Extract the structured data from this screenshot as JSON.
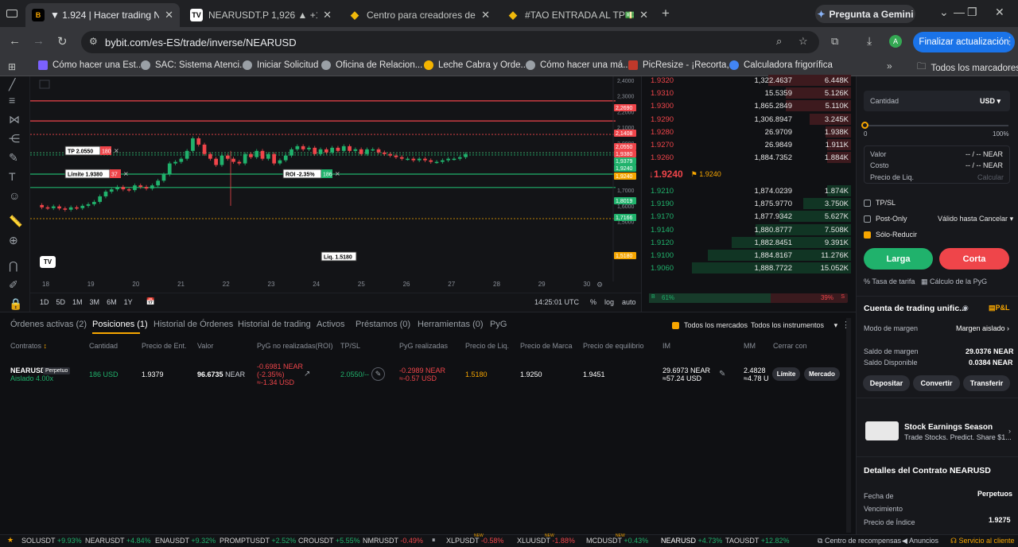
{
  "browser": {
    "tabs": [
      {
        "title": "▼ 1.924 | Hacer trading NEARUSD"
      },
      {
        "title": "NEARUSDT.P 1,926 ▲ +1.42% en"
      },
      {
        "title": "Centro para creadores de Binance"
      },
      {
        "title": "#TAO ENTRADA AL TP💵💵 LO"
      }
    ],
    "gemini": "Pregunta a Gemini",
    "url": "bybit.com/es-ES/trade/inverse/NEARUSD",
    "profile": "A",
    "update": "Finalizar actualización",
    "bookmarks": [
      "Cómo hacer una Est...",
      "SAC: Sistema Atenci...",
      "Iniciar Solicitud",
      "Oficina de Relacion...",
      "Leche Cabra y Orde...",
      "Cómo hacer una má...",
      "PicResize - ¡Recorta,...",
      "Calculadora frigorífica"
    ],
    "all_bookmarks": "Todos los marcadores"
  },
  "chart": {
    "price_axis": [
      "2,4000",
      "2,3000",
      "2,2000",
      "2,1000",
      "2,0000",
      "1,9000",
      "1,8000",
      "1,7000",
      "1,6000",
      "1,5000"
    ],
    "price_tags": [
      {
        "label": "2,2690",
        "color": "#ef454a"
      },
      {
        "label": "2,1408",
        "color": "#ef454a"
      },
      {
        "label": "2,0550",
        "color": "#ef454a"
      },
      {
        "label": "1,9380",
        "color": "#ef454a"
      },
      {
        "label": "1,9379",
        "color": "#20b26c"
      },
      {
        "label": "1,9240",
        "color": "#20b26c"
      },
      {
        "label": "1,9240",
        "color": "#f7a600"
      },
      {
        "label": "1,8019",
        "color": "#20b26c"
      },
      {
        "label": "1,7166",
        "color": "#20b26c"
      },
      {
        "label": "1,5180",
        "color": "#f7a600"
      }
    ],
    "date_axis": [
      "18",
      "19",
      "20",
      "21",
      "22",
      "23",
      "24",
      "25",
      "26",
      "27",
      "28",
      "29",
      "30"
    ],
    "tp_label": "TP 2.0550",
    "tp_qty": "180",
    "limit_label": "Límite 1.9380",
    "limit_qty": "37",
    "roi_label": "ROI -2.35%",
    "roi_qty": "186",
    "liq_label": "Liq. 1.5180",
    "timeframes": [
      "1D",
      "5D",
      "1M",
      "3M",
      "6M",
      "1Y"
    ],
    "clock": "14:25:01 UTC",
    "scale_opts": [
      "%",
      "log",
      "auto"
    ],
    "logo": "TV"
  },
  "orderbook": {
    "asks": [
      {
        "p": "1.9320",
        "q": "1,322.4637",
        "t": "6.448K",
        "w": 0.52
      },
      {
        "p": "1.9310",
        "q": "15.5359",
        "t": "5.126K",
        "w": 0.41
      },
      {
        "p": "1.9300",
        "q": "1,865.2849",
        "t": "5.110K",
        "w": 0.41
      },
      {
        "p": "1.9290",
        "q": "1,306.8947",
        "t": "3.245K",
        "w": 0.26
      },
      {
        "p": "1.9280",
        "q": "26.9709",
        "t": "1.938K",
        "w": 0.16
      },
      {
        "p": "1.9270",
        "q": "26.9849",
        "t": "1.911K",
        "w": 0.15
      },
      {
        "p": "1.9260",
        "q": "1,884.7352",
        "t": "1.884K",
        "w": 0.15
      }
    ],
    "last": "↓1.9240",
    "mark": "1.9240",
    "bids": [
      {
        "p": "1.9210",
        "q": "1,874.0239",
        "t": "1.874K",
        "w": 0.15
      },
      {
        "p": "1.9190",
        "q": "1,875.9770",
        "t": "3.750K",
        "w": 0.3
      },
      {
        "p": "1.9170",
        "q": "1,877.9342",
        "t": "5.627K",
        "w": 0.45
      },
      {
        "p": "1.9140",
        "q": "1,880.8777",
        "t": "7.508K",
        "w": 0.6
      },
      {
        "p": "1.9120",
        "q": "1,882.8451",
        "t": "9.391K",
        "w": 0.75
      },
      {
        "p": "1.9100",
        "q": "1,884.8167",
        "t": "11.276K",
        "w": 0.9
      },
      {
        "p": "1.9060",
        "q": "1,888.7722",
        "t": "15.052K",
        "w": 1.0
      }
    ],
    "buy_pct": "61%",
    "sell_pct": "39%",
    "b": "B",
    "s": "S"
  },
  "order_form": {
    "qty_label": "Cantidad",
    "qty_unit": "USD",
    "slider_min": "0",
    "slider_max": "100%",
    "valor": "Valor",
    "valor_val": "-- / -- NEAR",
    "costo": "Costo",
    "costo_val": "-- / -- NEAR",
    "liq": "Precio de Liq.",
    "liq_val": "Calcular",
    "tpsl": "TP/SL",
    "postonly": "Post-Only",
    "valid": "Válido hasta Cancelar",
    "reduce": "Sólo-Reducir",
    "long": "Larga",
    "short": "Corta",
    "fees": "Tasa de tarifa",
    "calc": "Cálculo de la PyG",
    "account_title": "Cuenta de trading unific...",
    "pl": "P&L",
    "margin_mode": "Modo de margen",
    "margin_mode_val": "Margen aislado",
    "margin_bal": "Saldo de margen",
    "margin_bal_val": "29.0376 NEAR",
    "avail_bal": "Saldo Disponible",
    "avail_bal_val": "0.0384 NEAR",
    "deposit": "Depositar",
    "convert": "Convertir",
    "transfer": "Transferir",
    "promo_title": "Stock Earnings Season",
    "promo_text": "Trade Stocks. Predict. Share $1...",
    "contract_title": "Detalles del Contrato NEARUSD",
    "exp": "Fecha de Vencimiento",
    "exp_val": "Perpetuos",
    "index": "Precio de Índice",
    "index_val": "1.9275"
  },
  "positions": {
    "tabs": [
      "Órdenes activas (2)",
      "Posiciones (1)",
      "Historial de Órdenes",
      "Historial de trading",
      "Activos",
      "Préstamos (0)",
      "Herramientas (0)",
      "PyG"
    ],
    "all_markets": "Todos los mercados",
    "all_instruments": "Todos los instrumentos",
    "headers": [
      "Contratos",
      "Cantidad",
      "Precio de Ent.",
      "Valor",
      "PyG no realizadas(ROI)",
      "TP/SL",
      "PyG realizadas",
      "Precio de Liq.",
      "Precio de Marca",
      "Precio de equilibrio",
      "IM",
      "MM",
      "Cerrar con"
    ],
    "row": {
      "contract": "NEARUSD",
      "type": "Perpetuo",
      "mode": "Aislado 4.00x",
      "qty": "186 USD",
      "entry": "1.9379",
      "value": "96.6735",
      "value_unit": "NEAR",
      "upnl1": "-0.6981 NEAR",
      "upnl2": "(-2.35%)",
      "upnl3": "≈-1.34 USD",
      "tpsl": "2.0550/--",
      "rpnl1": "-0.2989 NEAR",
      "rpnl2": "≈-0.57 USD",
      "liq": "1.5180",
      "mark": "1.9250",
      "be": "1.9451",
      "im1": "29.6973 NEAR",
      "im2": "≈57.24 USD",
      "mm1": "2.4828",
      "mm2": "≈4.78 U",
      "limit_btn": "Límite",
      "market_btn": "Mercado"
    }
  },
  "ticker": [
    {
      "sym": "SOLUSDT",
      "chg": "+9.93%",
      "dir": "up"
    },
    {
      "sym": "NEARUSDT",
      "chg": "+4.84%",
      "dir": "up"
    },
    {
      "sym": "ENAUSDT",
      "chg": "+9.32%",
      "dir": "up"
    },
    {
      "sym": "PROMPTUSDT",
      "chg": "+2.52%",
      "dir": "up"
    },
    {
      "sym": "CROUSDT",
      "chg": "+5.55%",
      "dir": "up"
    },
    {
      "sym": "NMRUSDT",
      "chg": "-0.49%",
      "dir": "dn"
    },
    {
      "sym": "XLPUSDT",
      "chg": "-0.58%",
      "dir": "dn"
    },
    {
      "sym": "XLUUSDT",
      "chg": "-1.88%",
      "dir": "dn"
    },
    {
      "sym": "MCDUSDT",
      "chg": "+0.43%",
      "dir": "up"
    },
    {
      "sym": "NEARUSD",
      "chg": "+4.73%",
      "dir": "up"
    },
    {
      "sym": "TAOUSDT",
      "chg": "+12.82%",
      "dir": "up"
    }
  ],
  "ticker_new": "NEW",
  "footer": {
    "rewards": "Centro de recompensas",
    "announce": "Anuncios",
    "support": "Servicio al cliente"
  }
}
